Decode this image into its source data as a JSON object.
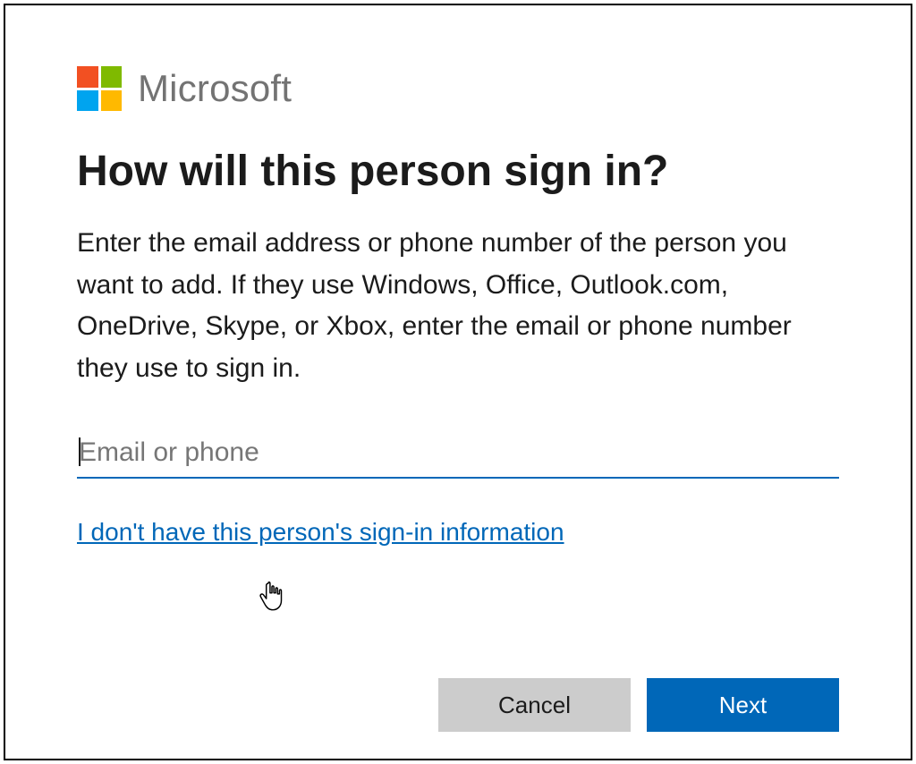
{
  "brand": {
    "name": "Microsoft",
    "logo_colors": {
      "tl": "#f25022",
      "tr": "#7fba00",
      "bl": "#00a4ef",
      "br": "#ffb900"
    }
  },
  "heading": "How will this person sign in?",
  "body": "Enter the email address or phone number of the person you want to add. If they use Windows, Office, Outlook.com, OneDrive, Skype, or Xbox, enter the email or phone number they use to sign in.",
  "input": {
    "value": "",
    "placeholder": "Email or phone"
  },
  "alt_link": "I don't have this person's sign-in information",
  "buttons": {
    "cancel": "Cancel",
    "next": "Next"
  },
  "colors": {
    "accent": "#0067b8",
    "button_gray": "#cccccc"
  }
}
